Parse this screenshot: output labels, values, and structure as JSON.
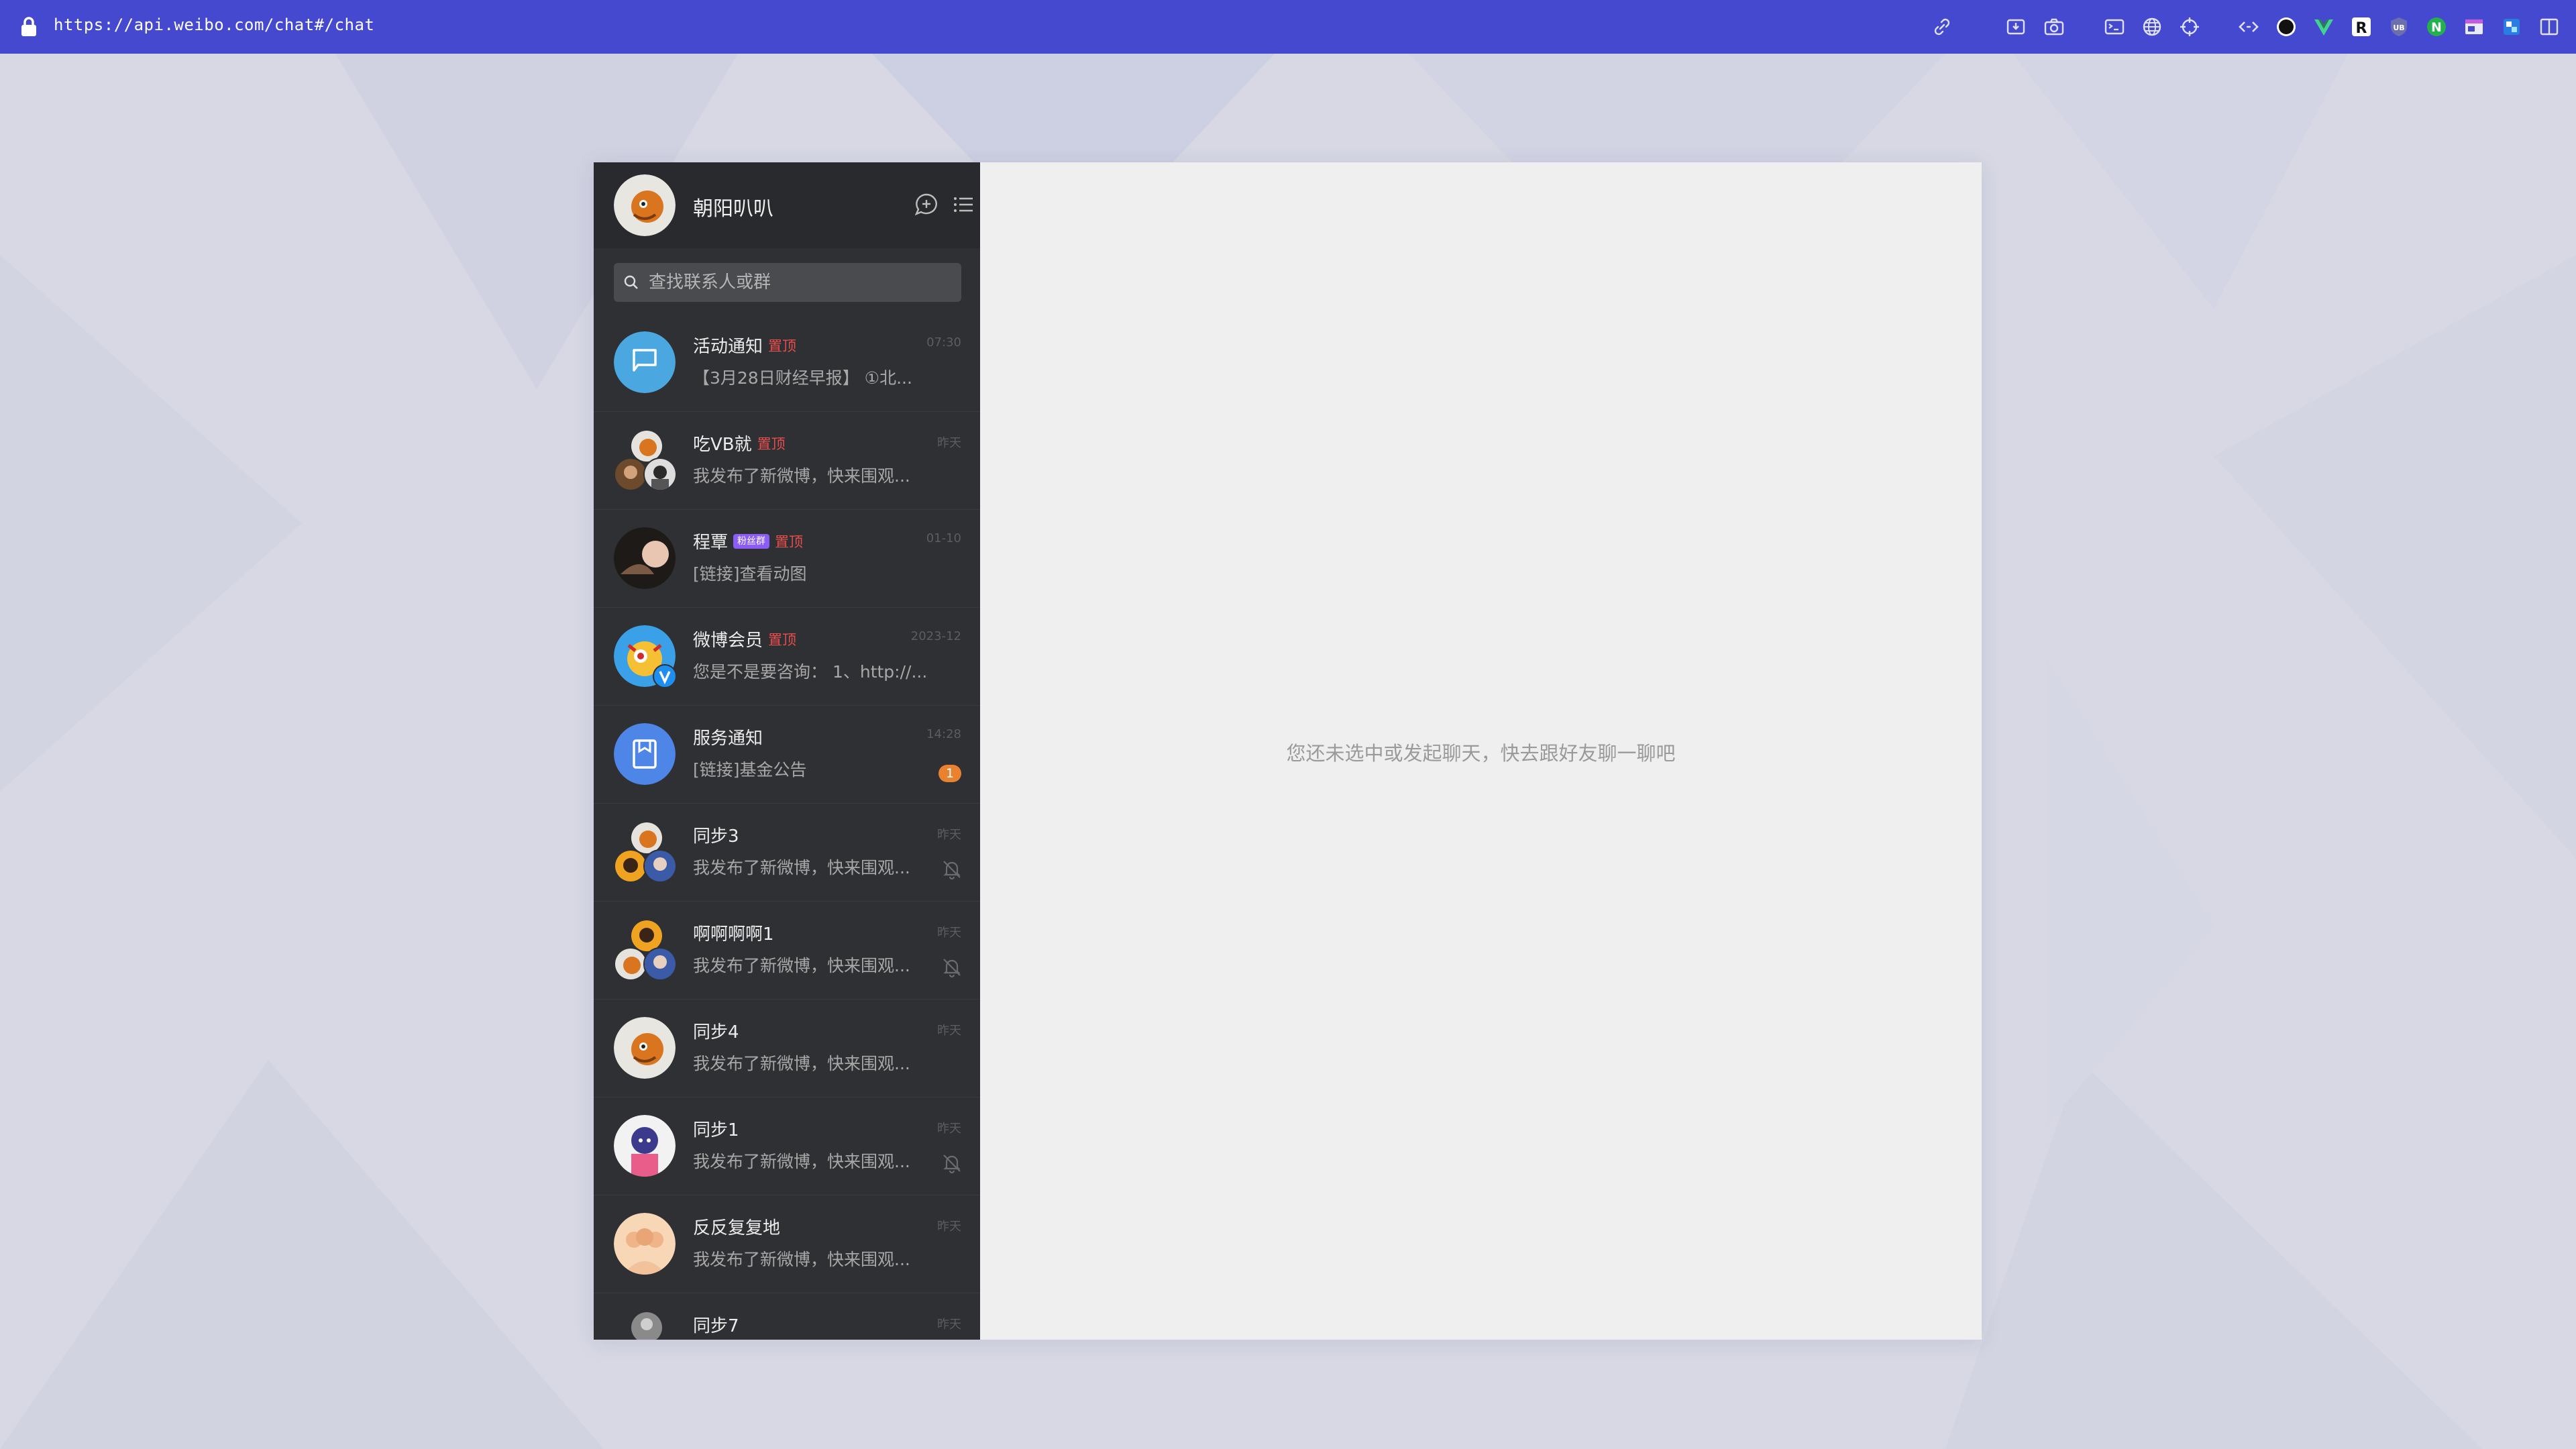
{
  "browser": {
    "url": "https://api.weibo.com/chat#/chat",
    "toolbar_icons": [
      "link-icon",
      "download-tray-icon",
      "camera-icon",
      "terminal-icon",
      "globe-icon",
      "crosshair-icon",
      "code-brackets-icon",
      "dark-circle-extension-icon",
      "vue-devtools-icon",
      "r-extension-icon",
      "shield-extension-icon",
      "n-extension-icon",
      "window-extension-icon",
      "puzzle-extension-icon",
      "sidebar-toggle-icon"
    ]
  },
  "colors": {
    "topbar": "#4549cf",
    "sidebar": "#2f3033",
    "main_bg": "#efefef",
    "pin_red": "#e64d4d",
    "unread_orange": "#e8822f"
  },
  "sidebar": {
    "profile_name": "朝阳叭叭",
    "search_placeholder": "查找联系人或群",
    "conversations": [
      {
        "title": "活动通知",
        "pin": "置顶",
        "time": "07:30",
        "preview": "【3月28日财经早报】 ①北...",
        "avatar": "flag-icon"
      },
      {
        "title": "吃VB就",
        "pin": "置顶",
        "time": "昨天",
        "preview": "我发布了新微博，快来围观...",
        "avatar": "group-avatar"
      },
      {
        "title": "程覃",
        "badge": "粉丝群",
        "pin": "置顶",
        "time": "01-10",
        "preview": "[链接]查看动图",
        "avatar": "user-avatar"
      },
      {
        "title": "微博会员",
        "pin": "置顶",
        "time": "2023-12",
        "preview": "您是不是要咨询： 1、http://...",
        "avatar": "verified-avatar"
      },
      {
        "title": "服务通知",
        "time": "14:28",
        "preview": "[链接]基金公告",
        "unread": "1",
        "avatar": "bookmark-icon"
      },
      {
        "title": "同步3",
        "time": "昨天",
        "preview": "我发布了新微博，快来围观...",
        "muted": true,
        "avatar": "group-avatar"
      },
      {
        "title": "啊啊啊啊1",
        "time": "昨天",
        "preview": "我发布了新微博，快来围观...",
        "muted": true,
        "avatar": "group-avatar"
      },
      {
        "title": "同步4",
        "time": "昨天",
        "preview": "我发布了新微博，快来围观...",
        "avatar": "user-avatar"
      },
      {
        "title": "同步1",
        "time": "昨天",
        "preview": "我发布了新微博，快来围观...",
        "muted": true,
        "avatar": "user-avatar"
      },
      {
        "title": "反反复复地",
        "time": "昨天",
        "preview": "我发布了新微博，快来围观...",
        "avatar": "user-avatar"
      },
      {
        "title": "同步7",
        "time": "昨天",
        "preview": "",
        "avatar": "group-avatar"
      }
    ]
  },
  "main": {
    "empty_text": "您还未选中或发起聊天，快去跟好友聊一聊吧"
  }
}
